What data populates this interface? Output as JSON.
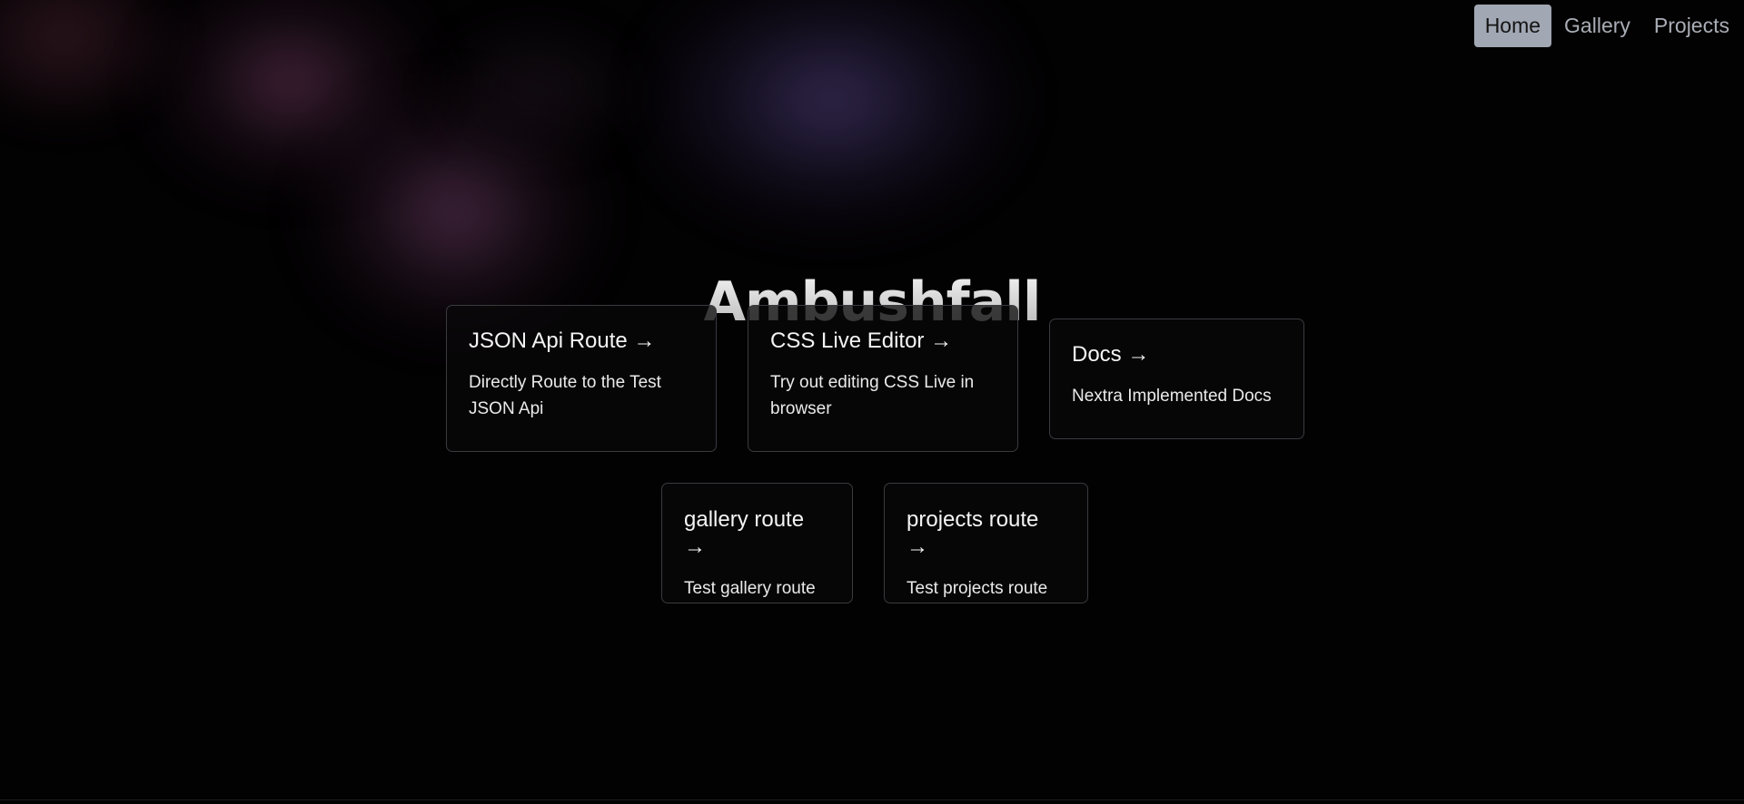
{
  "nav": {
    "items": [
      {
        "label": "Home",
        "active": true
      },
      {
        "label": "Gallery",
        "active": false
      },
      {
        "label": "Projects",
        "active": false
      }
    ]
  },
  "hero": {
    "title": "Ambushfall"
  },
  "cards": [
    {
      "title": "JSON Api Route →",
      "description": "Directly Route to the Test JSON Api"
    },
    {
      "title": "CSS Live Editor →",
      "description": "Try out editing CSS Live in browser"
    },
    {
      "title": "Docs →",
      "description": "Nextra Implemented Docs"
    },
    {
      "title": "gallery route →",
      "description": "Test gallery route"
    },
    {
      "title": "projects route →",
      "description": "Test projects route"
    }
  ],
  "colors": {
    "background": "#030203",
    "nav_active_bg": "#a1a7b3",
    "nav_text": "#a9adb5",
    "card_border": "#3a3a3f",
    "glow_magenta": "#5c3456",
    "glow_indigo": "#3e3260"
  }
}
